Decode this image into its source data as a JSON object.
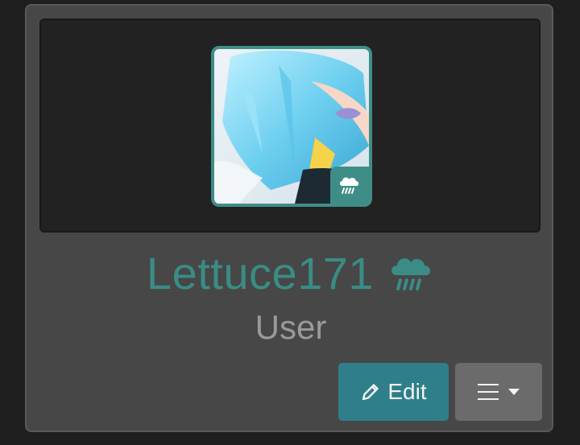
{
  "profile": {
    "username": "Lettuce171",
    "role": "User",
    "status_icon": "rain-cloud-icon",
    "accent_color": "#3a8c85"
  },
  "actions": {
    "edit_label": "Edit",
    "edit_icon": "pencil-icon",
    "menu_icon": "hamburger-menu-icon",
    "menu_caret_icon": "caret-down-icon"
  }
}
